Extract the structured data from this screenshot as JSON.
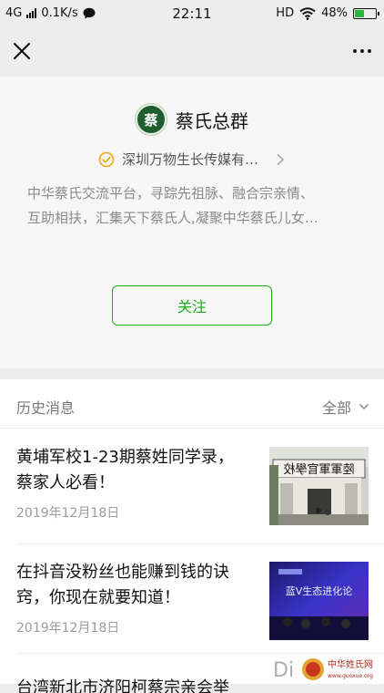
{
  "status": {
    "network": "4G",
    "speed": "0.1K/s",
    "time": "22:11",
    "hd": "HD",
    "battery": "48%",
    "battery_level": 0.48
  },
  "account": {
    "logo_char": "蔡",
    "name": "蔡氏总群",
    "verified_org": "深圳万物生长传媒有…",
    "description": [
      "中华蔡氏交流平台，寻踪先祖脉、融合宗亲情、",
      "互助相扶，汇集天下蔡氏人,凝聚中华蔡氏儿女…"
    ],
    "follow_label": "关注"
  },
  "history": {
    "title": "历史消息",
    "filter_label": "全部",
    "articles": [
      {
        "title": "黄埔军校1-23期蔡姓同学录，蔡家人必看！",
        "date": "2019年12月18日",
        "thumb_text": "陸軍軍官學校"
      },
      {
        "title": "在抖音没粉丝也能赚到钱的诀窍，你现在就要知道！",
        "date": "2019年12月18日",
        "thumb_text": "蓝V生态进化论"
      }
    ],
    "partial_title": "台湾新北市济阳柯蔡宗亲会举"
  },
  "watermark": {
    "text": "中华姓氏网",
    "sub": "www.guoxue.org"
  },
  "colors": {
    "accent": "#1aad19",
    "background": "#ededed",
    "profile_bg": "#f7f7f7",
    "logo_bg": "#1f5e2f"
  }
}
